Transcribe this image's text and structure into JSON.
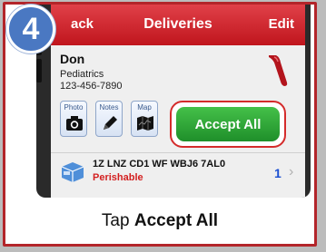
{
  "step": {
    "number": "4"
  },
  "navbar": {
    "back_label": "ack",
    "title": "Deliveries",
    "edit_label": "Edit"
  },
  "customer": {
    "name": "Don",
    "department": "Pediatrics",
    "phone": "123-456-7890"
  },
  "tools": [
    {
      "label": "Photo",
      "icon": "camera-icon"
    },
    {
      "label": "Notes",
      "icon": "pencil-icon"
    },
    {
      "label": "Map",
      "icon": "map-icon"
    }
  ],
  "accept_all_label": "Accept All",
  "delivery": {
    "tracking": "1Z LNZ CD1 WF WBJ6 7AL0",
    "status": "Perishable",
    "count": "1"
  },
  "caption": {
    "prefix": "Tap ",
    "emphasis": "Accept All"
  },
  "colors": {
    "nav_red": "#c0151d",
    "accept_green": "#2ea83a",
    "badge_blue": "#4a78c2",
    "frame_red": "#b3252a"
  }
}
